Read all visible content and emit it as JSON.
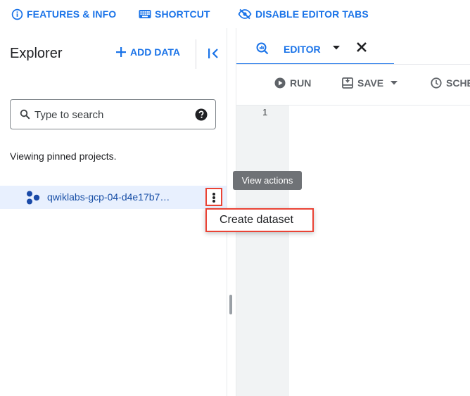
{
  "topbar": {
    "features_label": "FEATURES & INFO",
    "shortcut_label": "SHORTCUT",
    "disable_tabs_label": "DISABLE EDITOR TABS"
  },
  "explorer": {
    "title": "Explorer",
    "add_data_label": "ADD DATA",
    "search_placeholder": "Type to search",
    "pinned_note": "Viewing pinned projects.",
    "project_name": "qwiklabs-gcp-04-d4e17b7…",
    "tooltip": "View actions",
    "menu_item": "Create dataset"
  },
  "editor": {
    "tab_label": "EDITOR",
    "run_label": "RUN",
    "save_label": "SAVE",
    "schedule_label": "SCHE",
    "line_number": "1"
  },
  "colors": {
    "accent": "#1a73e8",
    "highlight_border": "#ea4335",
    "selected_row": "#e8f0fe"
  }
}
